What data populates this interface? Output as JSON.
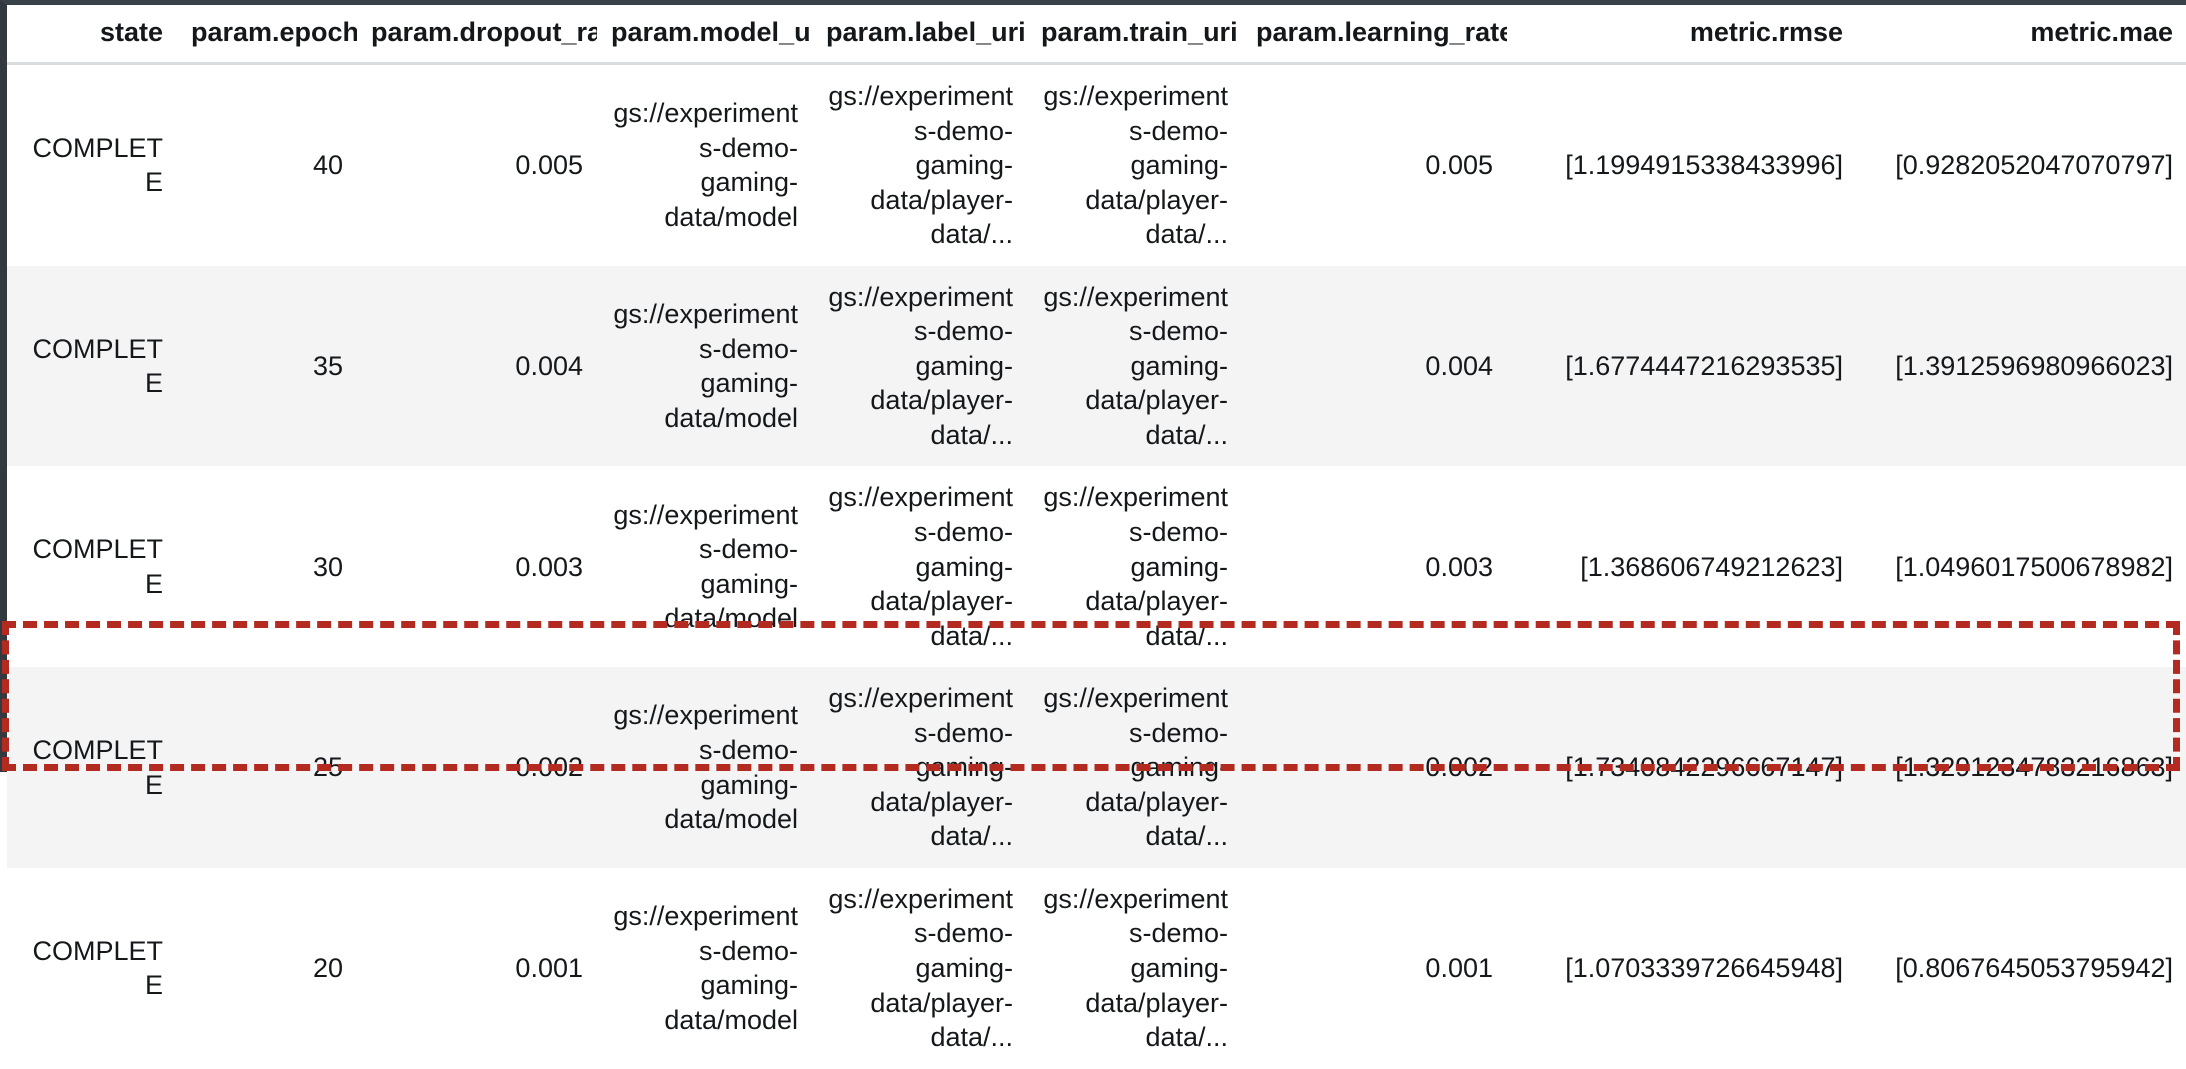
{
  "table": {
    "columns": [
      {
        "key": "state",
        "label": "state",
        "align": "left"
      },
      {
        "key": "param_epochs",
        "label": "param.epochs",
        "align": "right"
      },
      {
        "key": "param_dropout_rate",
        "label": "param.dropout_rate",
        "align": "right"
      },
      {
        "key": "param_model_uri",
        "label": "param.model_uri",
        "align": "right"
      },
      {
        "key": "param_label_uri",
        "label": "param.label_uri",
        "align": "right"
      },
      {
        "key": "param_train_uri",
        "label": "param.train_uri",
        "align": "right"
      },
      {
        "key": "param_learning_rate",
        "label": "param.learning_rate",
        "align": "right"
      },
      {
        "key": "metric_rmse",
        "label": "metric.rmse",
        "align": "right"
      },
      {
        "key": "metric_mae",
        "label": "metric.mae",
        "align": "right"
      }
    ],
    "rows": [
      {
        "state": "COMPLETE",
        "param_epochs": "40",
        "param_dropout_rate": "0.005",
        "param_model_uri": "gs://experiments-demo-gaming-data/model",
        "param_label_uri": "gs://experiments-demo-gaming-data/player-data/...",
        "param_train_uri": "gs://experiments-demo-gaming-data/player-data/...",
        "param_learning_rate": "0.005",
        "metric_rmse": "[1.1994915338433996]",
        "metric_mae": "[0.9282052047070797]",
        "highlighted": false
      },
      {
        "state": "COMPLETE",
        "param_epochs": "35",
        "param_dropout_rate": "0.004",
        "param_model_uri": "gs://experiments-demo-gaming-data/model",
        "param_label_uri": "gs://experiments-demo-gaming-data/player-data/...",
        "param_train_uri": "gs://experiments-demo-gaming-data/player-data/...",
        "param_learning_rate": "0.004",
        "metric_rmse": "[1.6774447216293535]",
        "metric_mae": "[1.3912596980966023]",
        "highlighted": false
      },
      {
        "state": "COMPLETE",
        "param_epochs": "30",
        "param_dropout_rate": "0.003",
        "param_model_uri": "gs://experiments-demo-gaming-data/model",
        "param_label_uri": "gs://experiments-demo-gaming-data/player-data/...",
        "param_train_uri": "gs://experiments-demo-gaming-data/player-data/...",
        "param_learning_rate": "0.003",
        "metric_rmse": "[1.368606749212623]",
        "metric_mae": "[1.0496017500678982]",
        "highlighted": false
      },
      {
        "state": "COMPLETE",
        "param_epochs": "25",
        "param_dropout_rate": "0.002",
        "param_model_uri": "gs://experiments-demo-gaming-data/model",
        "param_label_uri": "gs://experiments-demo-gaming-data/player-data/...",
        "param_train_uri": "gs://experiments-demo-gaming-data/player-data/...",
        "param_learning_rate": "0.002",
        "metric_rmse": "[1.7340842296667147]",
        "metric_mae": "[1.3291234783216863]",
        "highlighted": false
      },
      {
        "state": "COMPLETE",
        "param_epochs": "20",
        "param_dropout_rate": "0.001",
        "param_model_uri": "gs://experiments-demo-gaming-data/model",
        "param_label_uri": "gs://experiments-demo-gaming-data/player-data/...",
        "param_train_uri": "gs://experiments-demo-gaming-data/player-data/...",
        "param_learning_rate": "0.001",
        "metric_rmse": "[1.0703339726645948]",
        "metric_mae": "[0.8067645053795942]",
        "highlighted": true
      }
    ]
  },
  "annotation": {
    "highlight_color": "#b22a20",
    "highlight_style": "dashed",
    "highlight_target_row_index": 4
  },
  "colors": {
    "row_odd_background": "#ffffff",
    "row_even_background": "#f4f4f4",
    "text": "#15181b",
    "header_rule": "#d9dcdf",
    "frame": "#323a40"
  }
}
